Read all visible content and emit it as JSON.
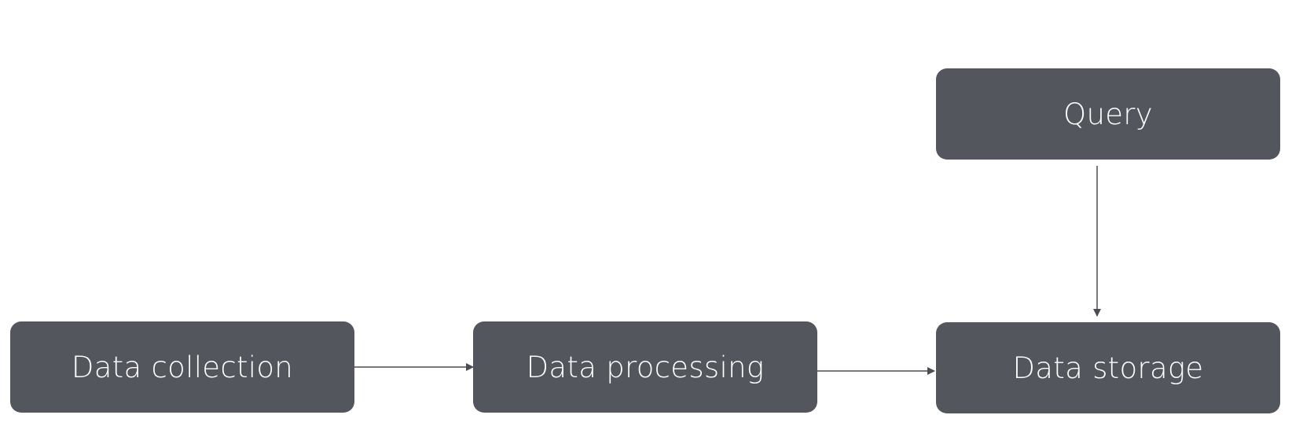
{
  "diagram": {
    "nodes": {
      "query": {
        "label": "Query"
      },
      "collection": {
        "label": "Data collection"
      },
      "processing": {
        "label": "Data processing"
      },
      "storage": {
        "label": "Data storage"
      }
    },
    "edges": [
      {
        "from": "collection",
        "to": "processing"
      },
      {
        "from": "processing",
        "to": "storage"
      },
      {
        "from": "query",
        "to": "storage"
      }
    ],
    "colors": {
      "node_fill": "#53575d",
      "node_text": "#ffffff",
      "edge": "#4a4d52"
    }
  }
}
